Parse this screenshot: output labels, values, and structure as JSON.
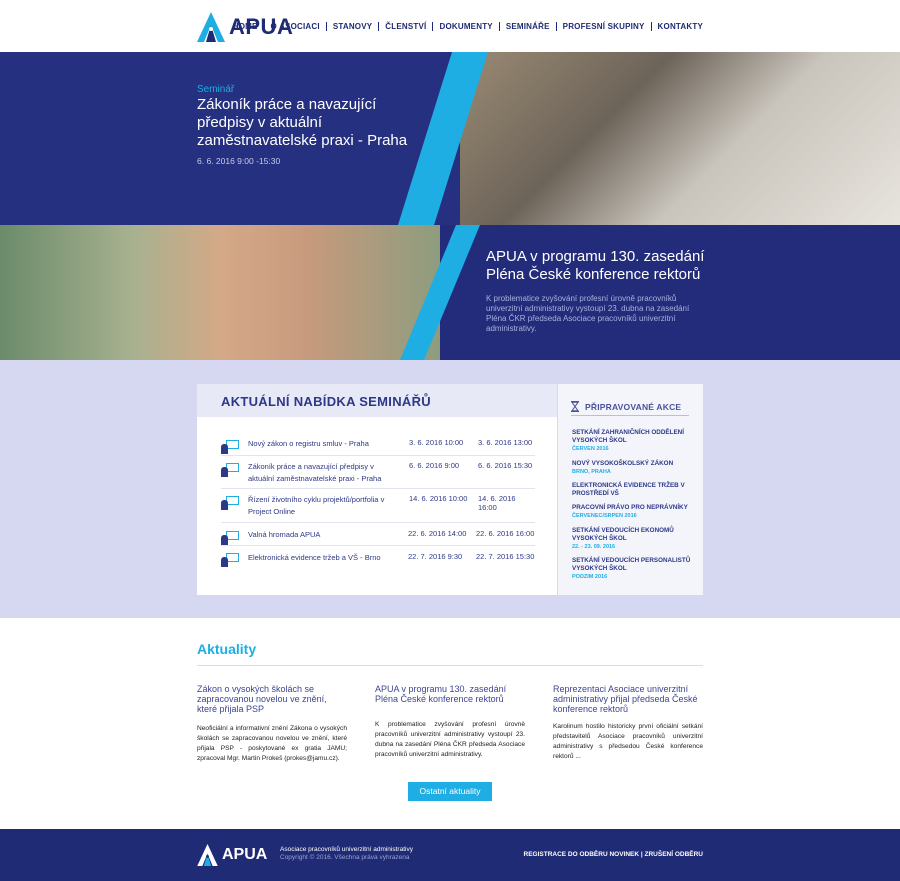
{
  "brand": {
    "name": "APUA",
    "accent": "#1eaee3",
    "primary": "#1f2b74"
  },
  "nav": [
    "HOME",
    "O ASOCIACI",
    "STANOVY",
    "ČLENSTVÍ",
    "DOKUMENTY",
    "SEMINÁŘE",
    "PROFESNÍ SKUPINY",
    "KONTAKTY"
  ],
  "hero1": {
    "kicker": "Seminář",
    "title": "Zákoník práce a navazující předpisy v aktuální zaměstnavatelské praxi - Praha",
    "date": "6. 6. 2016 9:00     -15:30"
  },
  "hero2": {
    "title": "APUA v programu 130. zasedání Pléna České konference rektorů",
    "text": "K problematice zvyšování profesní úrovně pracovníků univerzitní administrativy vystoupí 23. dubna na zasedání Pléna ČKR předseda Asociace pracovníků univerzitní administrativy."
  },
  "seminars": {
    "title": "AKTUÁLNÍ NABÍDKA SEMINÁŘŮ",
    "rows": [
      {
        "name": "Nový zákon o registru smluv - Praha",
        "from": "3. 6. 2016 10:00",
        "to": "3. 6. 2016 13:00"
      },
      {
        "name": "Zákoník práce a navazující předpisy v aktuální zaměstnavatelské praxi - Praha",
        "from": "6. 6. 2016 9:00",
        "to": "6. 6. 2016 15:30"
      },
      {
        "name": "Řízení životního cyklu projektů/portfolia v Project Online",
        "from": "14. 6. 2016 10:00",
        "to": "14. 6. 2016 16:00"
      },
      {
        "name": "Valná hromada APUA",
        "from": "22. 6. 2016 14:00",
        "to": "22. 6. 2016 16:00"
      },
      {
        "name": "Elektronická evidence tržeb a VŠ - Brno",
        "from": "22. 7. 2016 9:30",
        "to": "22. 7. 2016 15:30"
      }
    ]
  },
  "events": {
    "title": "PŘIPRAVOVANÉ AKCE",
    "items": [
      {
        "name": "SETKÁNÍ ZAHRANIČNÍCH ODDĚLENÍ VYSOKÝCH ŠKOL",
        "sub": "ČERVEN 2016"
      },
      {
        "name": "NOVÝ VYSOKOŠKOLSKÝ ZÁKON",
        "sub": "BRNO, PRAHA"
      },
      {
        "name": "ELEKTRONICKÁ EVIDENCE TRŽEB V PROSTŘEDÍ VŠ",
        "sub": ""
      },
      {
        "name": "PRACOVNÍ PRÁVO PRO NEPRÁVNÍKY",
        "sub": "ČERVENEC/SRPEN 2016"
      },
      {
        "name": "SETKÁNÍ VEDOUCÍCH EKONOMŮ VYSOKÝCH ŠKOL",
        "sub": "22. - 23. 09. 2016"
      },
      {
        "name": "SETKÁNÍ VEDOUCÍCH PERSONALISTŮ VYSOKÝCH ŠKOL",
        "sub": "PODZIM 2016"
      }
    ]
  },
  "news": {
    "title": "Aktuality",
    "items": [
      {
        "head": "Zákon o vysokých školách se zapracovanou novelou ve znění, které přijala PSP",
        "body": "Neoficiální a informativní znění Zákona o vysokých školách se zapracovanou novelou ve znění, které přijala PSP - poskytované ex gratia JAMU; zpracoval Mgr. Martin Prokeš (prokes@jamu.cz)."
      },
      {
        "head": "APUA v programu 130. zasedání Pléna České konference rektorů",
        "body": "K problematice zvyšování profesní úrovně pracovníků univerzitní administrativy vystoupí 23. dubna na zasedání Pléna ČKR předseda Asociace pracovníků univerzitní administrativy."
      },
      {
        "head": "Reprezentaci Asociace univerzitní administrativy přijal předseda České konference rektorů",
        "body": "Karolinum hostilo historicky první oficiální setkání představitelů Asociace pracovníků univerzitní administrativy s předsedou České konference rektorů ..."
      }
    ],
    "button": "Ostatní aktuality"
  },
  "footer": {
    "brand": "APUA",
    "org": "Asociace pracovníků univerzitní administrativy",
    "copy": "Copyright © 2016. Všechna práva vyhrazena",
    "links": "REGISTRACE DO ODBĚRU NOVINEK | ZRUŠENÍ ODBĚRU"
  }
}
